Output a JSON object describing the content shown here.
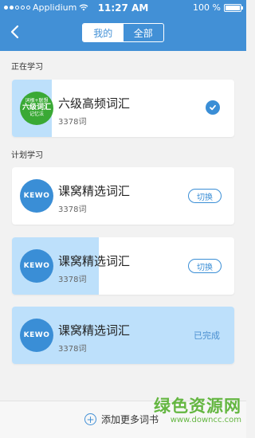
{
  "status_bar": {
    "carrier": "Applidium",
    "time": "11:27 AM",
    "battery": "100 %"
  },
  "header": {
    "tabs": [
      {
        "label": "我的",
        "active": true
      },
      {
        "label": "全部",
        "active": false
      }
    ]
  },
  "sections": {
    "current_title": "正在学习",
    "planned_title": "计划学习"
  },
  "current_book": {
    "title": "六级高频词汇",
    "word_count": "3378词",
    "cover_lines": [
      "六级词汇",
      "词根+联想",
      "记忆法"
    ],
    "progress": 0.18,
    "selected": true
  },
  "planned_books": [
    {
      "title": "课窝精选词汇",
      "word_count": "3378词",
      "logo": "KEWO",
      "action": "切换",
      "progress": 0
    },
    {
      "title": "课窝精选词汇",
      "word_count": "3378词",
      "logo": "KEWO",
      "action": "切换",
      "progress": 0.39
    },
    {
      "title": "课窝精选词汇",
      "word_count": "3378词",
      "logo": "KEWO",
      "status": "已完成",
      "progress": 1.0
    }
  ],
  "footer": {
    "add_label": "添加更多词书"
  },
  "watermark": {
    "text": "绿色资源网",
    "url": "www.downcc.com"
  },
  "colors": {
    "primary": "#4290d6",
    "progress": "#bde0fb",
    "watermark": "#55b02e"
  }
}
